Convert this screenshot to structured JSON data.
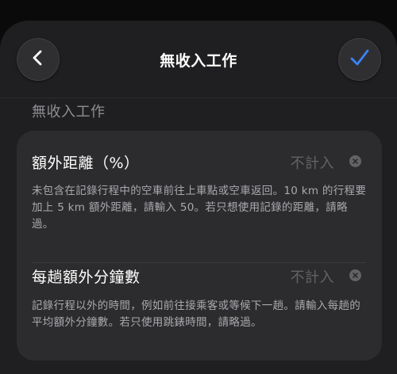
{
  "header": {
    "title": "無收入工作",
    "back_icon": "chevron-left-icon",
    "done_icon": "checkmark-icon",
    "accent_color": "#3b82f6"
  },
  "section": {
    "title": "無收入工作"
  },
  "rows": [
    {
      "label": "額外距離（%）",
      "value": "不計入",
      "description": "未包含在記錄行程中的空車前往上車點或空車返回。10 km 的行程要加上 5 km 額外距離，請輸入 50。若只想使用記錄的距離，請略過。"
    },
    {
      "label": "每趟額外分鐘數",
      "value": "不計入",
      "description": "記錄行程以外的時間，例如前往接乘客或等候下一趟。請輸入每趟的平均額外分鐘數。若只使用跳錶時間，請略過。"
    }
  ]
}
